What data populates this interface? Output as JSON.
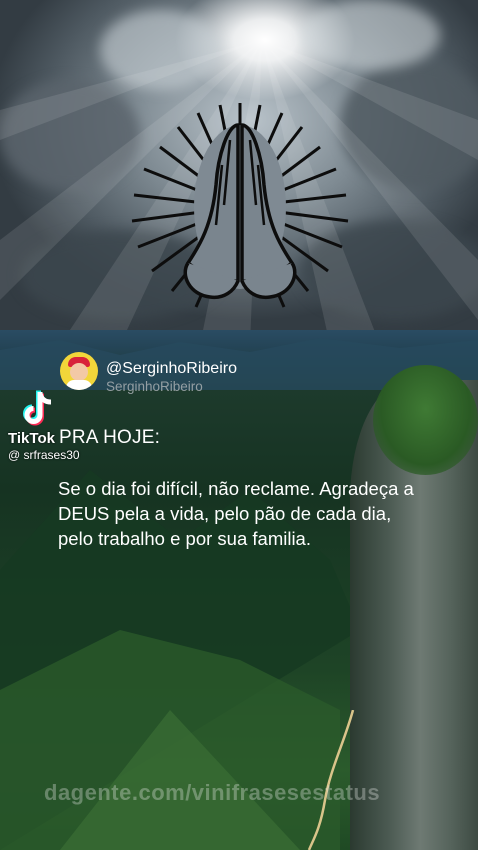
{
  "profile": {
    "display_name": "@SerginhoRibeiro",
    "username": "SerginhoRibeiro"
  },
  "tiktok": {
    "brand": "TikTok",
    "user": "@ srfrases30"
  },
  "post": {
    "heading": "PRA HOJE:",
    "message": "Se o dia foi  difícil, não reclame. Agradeça a DEUS pela a vida, pelo pão de cada dia, pelo trabalho e por sua familia."
  },
  "watermark": "dagente.com/vinifrasesestatus",
  "icons": [
    "praying-hands-icon",
    "tiktok-logo-icon"
  ],
  "colors": {
    "text": "#ffffff",
    "sky": "#7f8b93",
    "forest": "#1d3a2c"
  }
}
